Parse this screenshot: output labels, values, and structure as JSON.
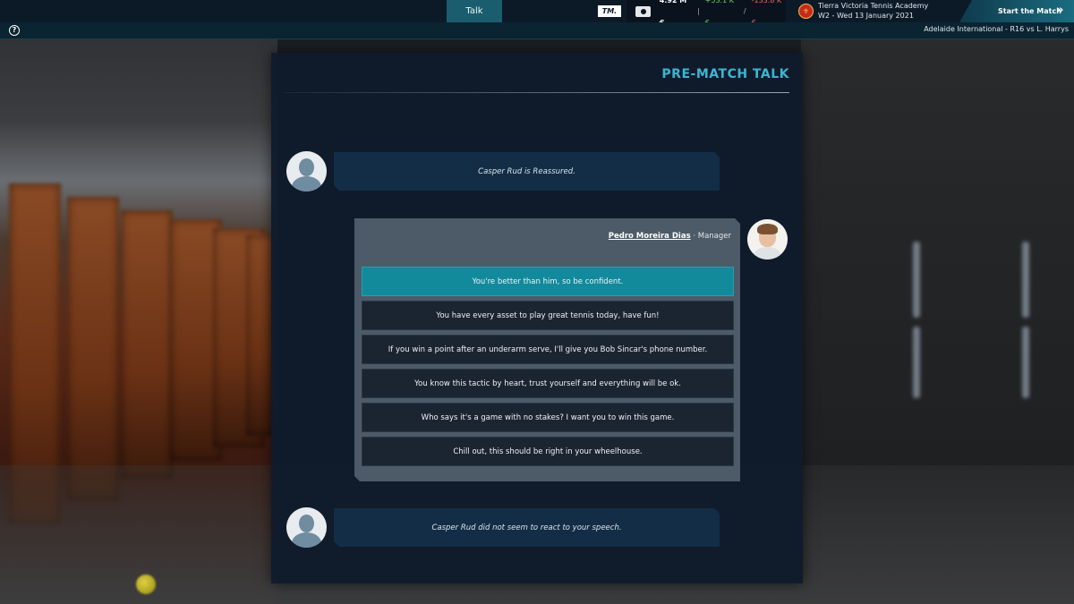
{
  "topbar": {
    "active_tab": "Talk",
    "logo": "TM.",
    "money_icon": "money-icon",
    "balance": "4.92 M €",
    "separator": "|",
    "income": "+53.1 K €",
    "slash": "/",
    "expense": "-133.8 K €",
    "club_name": "Tierra Victoria Tennis Academy",
    "date": "W2 - Wed 13 January 2021",
    "start_button": "Start the Match",
    "start_chevron": "»",
    "colors": {
      "income": "#6fd36f",
      "expense": "#f06a6a",
      "accent": "#1b6c80"
    }
  },
  "subbar": {
    "help_icon": "?",
    "match_info": "Adelaide International - R16 vs L. Harrys"
  },
  "panel": {
    "title": "PRE-MATCH TALK",
    "messages": [
      {
        "text": "Casper Rud is Reassured."
      },
      {
        "text": "Casper Rud did not seem to react to your speech."
      }
    ],
    "speaker": {
      "name": "Pedro Moreira Dias",
      "separator": " · ",
      "role": "Manager"
    },
    "options": [
      "You're better than him, so be confident.",
      "You have every asset to play great tennis today, have fun!",
      "If you win a point after an underarm serve, I'll give you Bob Sincar's phone number.",
      "You know this tactic by heart, trust yourself and everything will be ok.",
      "Who says it's a game with no stakes? I want you to win this game.",
      "Chill out, this should be right in your wheelhouse."
    ],
    "selected_option": 0,
    "accent_color": "#3bb6d2"
  }
}
